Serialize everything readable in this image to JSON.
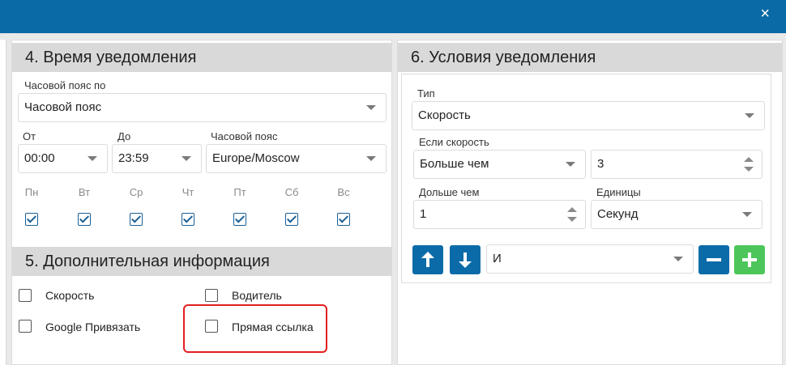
{
  "window": {
    "close_symbol": "×"
  },
  "section4": {
    "title": "4. Время уведомления",
    "tz_by_label": "Часовой пояс по",
    "tz_by_value": "Часовой пояс",
    "from_label": "От",
    "from_value": "00:00",
    "to_label": "До",
    "to_value": "23:59",
    "tz_label": "Часовой пояс",
    "tz_value": "Europe/Moscow",
    "days": [
      {
        "label": "Пн",
        "checked": true
      },
      {
        "label": "Вт",
        "checked": true
      },
      {
        "label": "Ср",
        "checked": true
      },
      {
        "label": "Чт",
        "checked": true
      },
      {
        "label": "Пт",
        "checked": true
      },
      {
        "label": "Сб",
        "checked": true
      },
      {
        "label": "Вс",
        "checked": true
      }
    ]
  },
  "section5": {
    "title": "5. Дополнительная информация",
    "options": [
      {
        "label": "Скорость",
        "checked": false
      },
      {
        "label": "Водитель",
        "checked": false
      },
      {
        "label": "Google Привязать",
        "checked": false
      },
      {
        "label": "Прямая ссылка",
        "checked": false
      }
    ],
    "highlight_color": "#e31e1e"
  },
  "section6": {
    "title": "6. Условия уведомления",
    "type_label": "Тип",
    "type_value": "Скорость",
    "if_speed_label": "Если скорость",
    "comparison_value": "Больше чем",
    "speed_value": "3",
    "longer_than_label": "Дольше чем",
    "duration_value": "1",
    "units_label": "Единицы",
    "units_value": "Секунд",
    "logic_value": "И"
  },
  "colors": {
    "header_blue": "#0a6aa5",
    "button_blue": "#0b6ba8",
    "button_green": "#4cc65b",
    "section_header_gray": "#d9d9d9"
  }
}
